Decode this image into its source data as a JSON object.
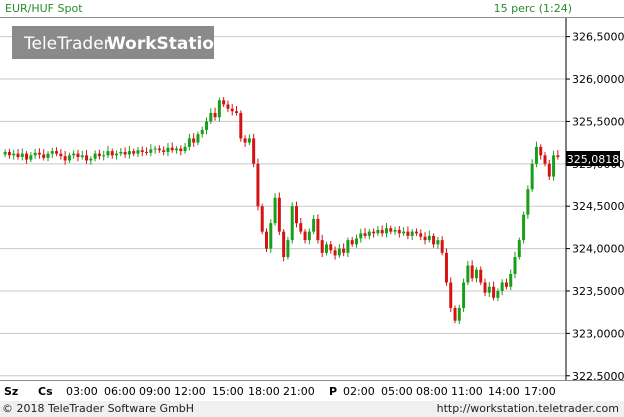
{
  "header": {
    "instrument": "EUR/HUF Spot",
    "interval": "15 perc (1:24)"
  },
  "watermark": {
    "brand_light": "TeleTrader",
    "brand_bold": "WorkStation"
  },
  "price_label": "325,0818",
  "footer": {
    "copyright": "© 2018 TeleTrader Software GmbH",
    "url": "http://workstation.teletrader.com"
  },
  "colors": {
    "up": "#1a9e1a",
    "down": "#d41414",
    "grid": "#c8c8c8",
    "header_text": "#2a8c2a"
  },
  "chart_data": {
    "type": "candlestick",
    "title": "EUR/HUF Spot",
    "ylim": [
      322.45,
      326.72
    ],
    "y_ticks": [
      "326,5000",
      "326,0000",
      "325,5000",
      "325,0000",
      "324,5000",
      "324,0000",
      "323,5000",
      "323,0000",
      "322,5000"
    ],
    "y_tick_values": [
      326.5,
      326.0,
      325.5,
      325.0,
      324.5,
      324.0,
      323.5,
      323.0,
      322.5
    ],
    "x_labels": [
      "Sz",
      "Cs",
      "03:00",
      "06:00",
      "09:00",
      "12:00",
      "15:00",
      "18:00",
      "21:00",
      "P",
      "02:00",
      "05:00",
      "08:00",
      "11:00",
      "14:00",
      "17:00"
    ],
    "last_price": 325.0818,
    "series": [
      {
        "values_close": [
          325.14,
          325.1,
          325.12,
          325.08,
          325.12,
          325.05,
          325.1,
          325.13,
          325.11,
          325.07,
          325.12,
          325.15,
          325.12,
          325.09,
          325.04,
          325.1,
          325.12,
          325.08,
          325.1,
          325.04,
          325.06,
          325.12,
          325.09,
          325.1,
          325.15,
          325.1,
          325.12,
          325.14,
          325.11,
          325.15,
          325.12,
          325.16,
          325.14,
          325.13,
          325.17,
          325.18,
          325.16,
          325.14,
          325.19,
          325.16,
          325.18,
          325.15,
          325.2,
          325.3,
          325.25,
          325.35,
          325.4,
          325.5,
          325.6,
          325.55,
          325.75,
          325.7,
          325.65,
          325.62,
          325.6,
          325.3,
          325.25,
          325.3,
          325.0,
          324.5,
          324.2,
          324.0,
          324.3,
          324.6,
          324.2,
          323.9,
          324.1,
          324.5,
          324.3,
          324.2,
          324.1,
          324.2,
          324.35,
          324.1,
          323.95,
          324.05,
          323.98,
          323.92,
          324.0,
          323.95,
          324.1,
          324.05,
          324.12,
          324.18,
          324.15,
          324.2,
          324.18,
          324.22,
          324.18,
          324.24,
          324.2,
          324.22,
          324.18,
          324.2,
          324.15,
          324.2,
          324.18,
          324.14,
          324.1,
          324.15,
          324.05,
          324.1,
          323.95,
          323.6,
          323.3,
          323.15,
          323.3,
          323.6,
          323.8,
          323.65,
          323.75,
          323.6,
          323.48,
          323.55,
          323.42,
          323.5,
          323.6,
          323.55,
          323.7,
          323.9,
          324.1,
          324.4,
          324.7,
          325.0,
          325.2,
          325.1,
          325.0,
          324.85,
          325.1,
          325.08
        ]
      }
    ]
  }
}
